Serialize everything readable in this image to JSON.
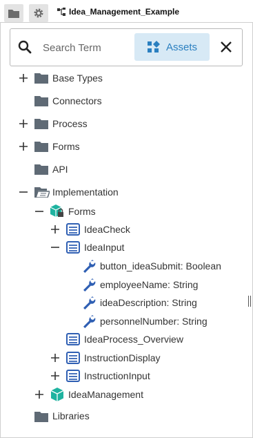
{
  "tab": {
    "title": "Idea_Management_Example"
  },
  "search": {
    "placeholder": "Search Term",
    "assets_label": "Assets"
  },
  "tree": {
    "base_types": "Base Types",
    "connectors": "Connectors",
    "process": "Process",
    "forms": "Forms",
    "api": "API",
    "implementation": "Implementation",
    "impl_forms": "Forms",
    "idea_check": "IdeaCheck",
    "idea_input": "IdeaInput",
    "fields": [
      "button_ideaSubmit: Boolean",
      "employeeName: String",
      "ideaDescription: String",
      "personnelNumber: String"
    ],
    "idea_process_overview": "IdeaProcess_Overview",
    "instruction_display": "InstructionDisplay",
    "instruction_input": "InstructionInput",
    "idea_management": "IdeaManagement",
    "libraries": "Libraries"
  },
  "colors": {
    "accent": "#2a7fc0",
    "folder": "#5f6a75",
    "teal": "#1fb3a0",
    "form_blue": "#2f5fb3"
  }
}
